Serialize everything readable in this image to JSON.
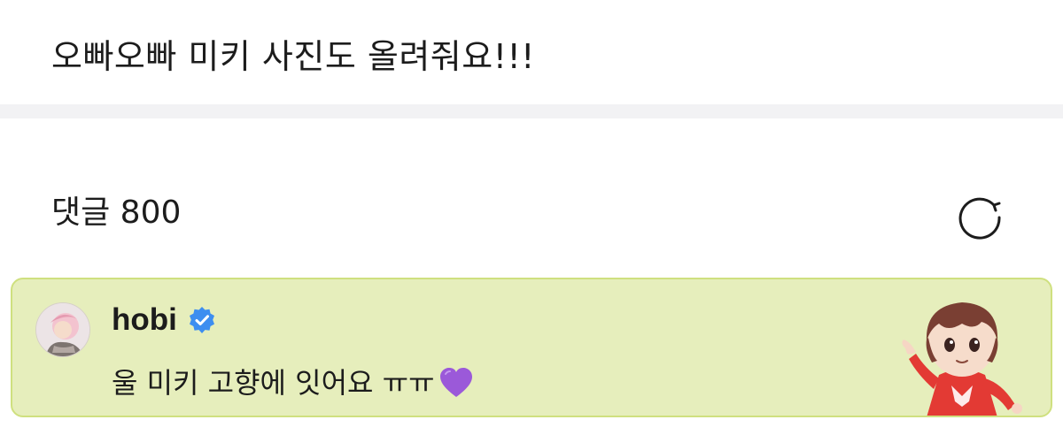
{
  "post": {
    "text": "오빠오빠 미키 사진도 올려줘요!!!"
  },
  "comments": {
    "title": "댓글 800",
    "refresh_icon": "refresh-icon"
  },
  "pinned_comment": {
    "username": "hobi",
    "verified_icon": "verified-badge-icon",
    "text": "울 미키 고향에 잇어요 ㅠㅠ",
    "emoji_icon": "purple-heart-icon",
    "colors": {
      "background": "#e6eebc",
      "border": "#cfe07f",
      "verified": "#3d8ef0",
      "heart": "#9b59d9"
    }
  }
}
